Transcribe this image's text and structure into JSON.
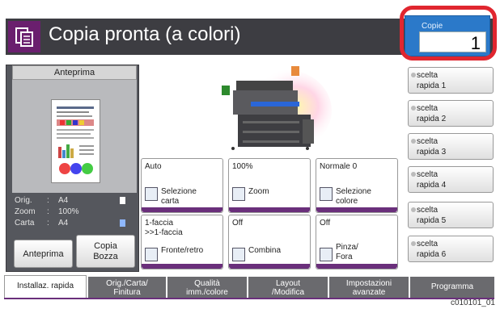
{
  "header": {
    "title": "Copia pronta (a colori)",
    "icon": "copy-icon"
  },
  "copies": {
    "label": "Copie",
    "value": "1"
  },
  "preview": {
    "tab_label": "Anteprima",
    "info": [
      {
        "key": "Orig.",
        "value": "A4"
      },
      {
        "key": "Zoom",
        "value": "100%"
      },
      {
        "key": "Carta",
        "value": "A4"
      }
    ],
    "preview_button": "Anteprima",
    "draft_button": {
      "line1": "Copia",
      "line2": "Bozza"
    }
  },
  "functions": [
    {
      "value": "Auto",
      "label1": "Selezione",
      "label2": "carta",
      "icon": "paper-select-icon"
    },
    {
      "value": "100%",
      "label1": "Zoom",
      "label2": "",
      "icon": "zoom-icon"
    },
    {
      "value": "Normale 0",
      "label1": "Selezione",
      "label2": "colore",
      "icon": "color-select-icon"
    },
    {
      "value": "1-faccia",
      "value2": ">>1-faccia",
      "label1": "Fronte/retro",
      "label2": "",
      "icon": "duplex-icon"
    },
    {
      "value": "Off",
      "label1": "Combina",
      "label2": "",
      "icon": "combine-icon"
    },
    {
      "value": "Off",
      "label1": "Pinza/",
      "label2": "Fora",
      "icon": "staple-icon"
    }
  ],
  "quick_buttons": [
    {
      "line1": "scelta",
      "line2": "rapida 1"
    },
    {
      "line1": "scelta",
      "line2": "rapida 2"
    },
    {
      "line1": "scelta",
      "line2": "rapida 3"
    },
    {
      "line1": "scelta",
      "line2": "rapida 4"
    },
    {
      "line1": "scelta",
      "line2": "rapida 5"
    },
    {
      "line1": "scelta",
      "line2": "rapida 6"
    }
  ],
  "tabs": [
    {
      "line1": "Installaz. rapida",
      "line2": ""
    },
    {
      "line1": "Orig./Carta/",
      "line2": "Finitura"
    },
    {
      "line1": "Qualità",
      "line2": "imm./colore"
    },
    {
      "line1": "Layout",
      "line2": "/Modifica"
    },
    {
      "line1": "Impostazioni",
      "line2": "avanzate"
    },
    {
      "line1": "Programma",
      "line2": ""
    }
  ],
  "figure_code": "c010101_01",
  "colors": {
    "header": "#3d3d42",
    "accent": "#6a1f6e",
    "copies": "#2b79c9",
    "highlight": "#e0262f"
  }
}
